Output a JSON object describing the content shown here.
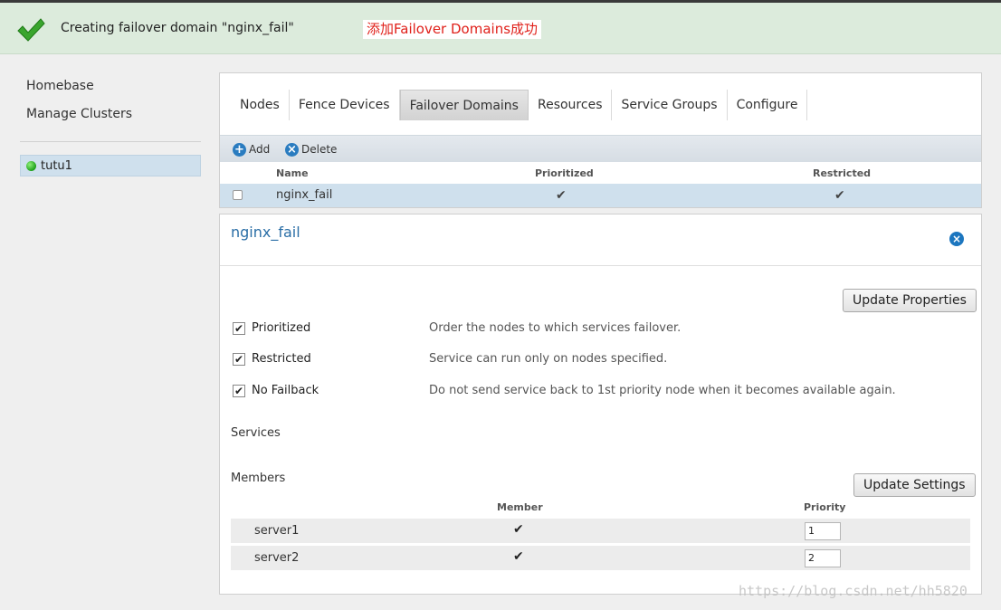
{
  "notification": {
    "message": "Creating failover domain \"nginx_fail\"",
    "annotation": "添加Failover Domains成功",
    "icon": "checkmark-icon"
  },
  "sidebar": {
    "links": [
      "Homebase",
      "Manage Clusters"
    ],
    "cluster": {
      "name": "tutu1",
      "status_color": "#22aa1a"
    }
  },
  "tabs": [
    "Nodes",
    "Fence Devices",
    "Failover Domains",
    "Resources",
    "Service Groups",
    "Configure"
  ],
  "active_tab": "Failover Domains",
  "toolbar": {
    "add_label": "Add",
    "delete_label": "Delete"
  },
  "domain_table": {
    "columns": [
      "Name",
      "Prioritized",
      "Restricted"
    ],
    "rows": [
      {
        "name": "nginx_fail",
        "prioritized": "✔",
        "restricted": "✔"
      }
    ]
  },
  "detail": {
    "title": "nginx_fail",
    "update_properties_label": "Update Properties",
    "options": [
      {
        "label": "Prioritized",
        "checked": "✔",
        "description": "Order the nodes to which services failover."
      },
      {
        "label": "Restricted",
        "checked": "✔",
        "description": "Service can run only on nodes specified."
      },
      {
        "label": "No Failback",
        "checked": "✔",
        "description": "Do not send service back to 1st priority node when it becomes available again."
      }
    ],
    "services_label": "Services",
    "members_label": "Members",
    "update_settings_label": "Update Settings",
    "member_columns": [
      "Member",
      "Priority"
    ],
    "members": [
      {
        "name": "server1",
        "member": "✔",
        "priority": "1"
      },
      {
        "name": "server2",
        "member": "✔",
        "priority": "2"
      }
    ]
  },
  "watermark": "https://blog.csdn.net/hh5820",
  "colors": {
    "accent": "#2a6ea6",
    "selected_row": "#cfe0ed",
    "notify_bg": "#dcebdc",
    "annotation_text": "#e0201a"
  }
}
